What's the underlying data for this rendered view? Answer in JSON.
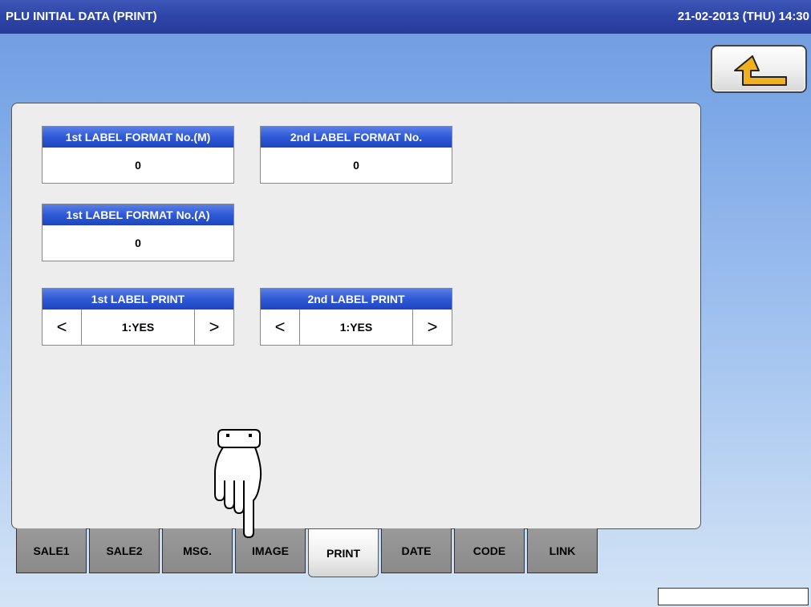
{
  "window": {
    "title": "PLU INITIAL DATA (PRINT)",
    "datetime": "21-02-2013 (THU)  14:30"
  },
  "back_button": {
    "icon": "return-arrow-icon",
    "color": "#f0b020"
  },
  "fields": [
    {
      "label": "1st LABEL FORMAT No.(M)",
      "value": "0"
    },
    {
      "label": "2nd LABEL FORMAT No.",
      "value": "0"
    },
    {
      "label": "1st LABEL FORMAT No.(A)",
      "value": "0"
    }
  ],
  "selectors": [
    {
      "label": "1st LABEL PRINT",
      "value": "1:YES",
      "prev": "<",
      "next": ">"
    },
    {
      "label": "2nd LABEL PRINT",
      "value": "1:YES",
      "prev": "<",
      "next": ">"
    }
  ],
  "tabs": [
    {
      "label": "SALE1"
    },
    {
      "label": "SALE2"
    },
    {
      "label": "MSG."
    },
    {
      "label": "IMAGE"
    },
    {
      "label": "PRINT",
      "active": true
    },
    {
      "label": "DATE"
    },
    {
      "label": "CODE"
    },
    {
      "label": "LINK"
    }
  ],
  "colors": {
    "title_bar": "#2e45a8",
    "field_header": "#2f59d6",
    "active_tab": "#ffffff",
    "inactive_tab": "#8a8a8a"
  },
  "pointer": {
    "icon": "pointing-hand-icon",
    "target": "IMAGE"
  }
}
